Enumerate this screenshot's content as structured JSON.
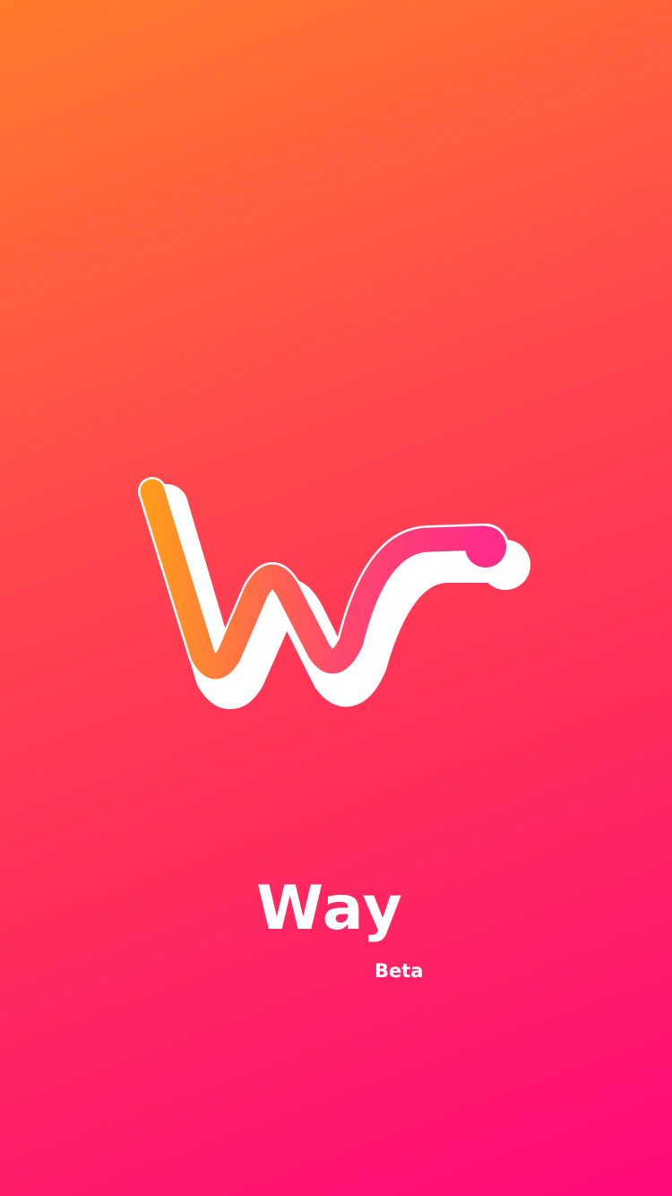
{
  "app": {
    "name": "Way",
    "badge": "Beta"
  },
  "logo": {
    "icon": "way-w-logo-icon",
    "gradient_start": "#ff9a1f",
    "gradient_end": "#ff2d8a",
    "outline_color": "#ffffff"
  },
  "colors": {
    "background_top": "#ff7a2c",
    "background_bottom": "#ff0a78",
    "text": "#ffffff"
  }
}
